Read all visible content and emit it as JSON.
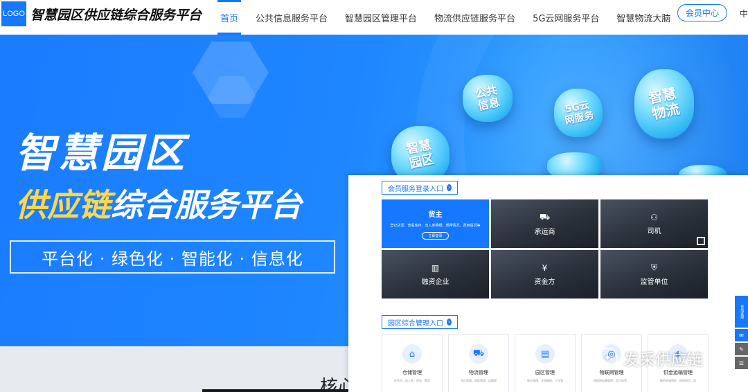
{
  "header": {
    "logo_text": "LOGO",
    "site_title": "智慧园区供应链综合服务平台",
    "nav": [
      {
        "label": "首页"
      },
      {
        "label": "公共信息服务平台"
      },
      {
        "label": "智慧园区管理平台"
      },
      {
        "label": "物流供应链服务平台"
      },
      {
        "label": "5G云网服务平台"
      },
      {
        "label": "智慧物流大脑"
      }
    ],
    "member_center": "会员中心",
    "lang": "中"
  },
  "banner": {
    "line1": "智慧园区",
    "line2_highlight": "供应链",
    "line2_rest": "综合服务平台",
    "slogan": "平台化 · 绿色化 · 智能化 · 信息化",
    "clouds": [
      {
        "text": "公共\n信息"
      },
      {
        "text": "5G云\n网服务"
      },
      {
        "text": "智慧\n物流"
      },
      {
        "text": "智慧\n园区"
      }
    ]
  },
  "panel": {
    "login_section_title": "会员服务登录入口",
    "tiles": [
      {
        "label": "货主",
        "icon": "user-icon",
        "desc": "登记货源、查看库存、出入库明细、质押情况、费用情况等",
        "button": "立即登录"
      },
      {
        "label": "承运商",
        "icon": "truck-icon"
      },
      {
        "label": "司机",
        "icon": "driver-icon"
      },
      {
        "label": "融资企业",
        "icon": "building-icon"
      },
      {
        "label": "资金方",
        "icon": "money-icon"
      },
      {
        "label": "监管单位",
        "icon": "shield-icon"
      }
    ],
    "mgmt_section_title": "园区综合管理入口",
    "mgmt_cards": [
      {
        "title": "仓储管理",
        "desc": "在仓货、出入库、库存、费用",
        "icon": "warehouse-icon"
      },
      {
        "title": "物流管理",
        "desc": "车队管理、调度管理、运输管",
        "icon": "truck-icon"
      },
      {
        "title": "园区管理",
        "desc": "物业管理、水电能耗、人车管",
        "icon": "document-icon"
      },
      {
        "title": "物联网管理",
        "desc": "物联网设备管理、定位标签、",
        "icon": "iot-icon"
      },
      {
        "title": "供金运输管理",
        "desc": "融资申请审批、担保授信、风",
        "icon": "finance-icon"
      }
    ],
    "side_tools": {
      "online": "在线客服",
      "chat": "chat-icon",
      "edit": "edit-icon",
      "menu": "menu-icon"
    }
  },
  "lower": {
    "partial_heading": "核心"
  },
  "watermark": {
    "text": "发采供应链"
  },
  "colors": {
    "primary": "#1677ff",
    "banner_highlight": "#ffd84a"
  }
}
